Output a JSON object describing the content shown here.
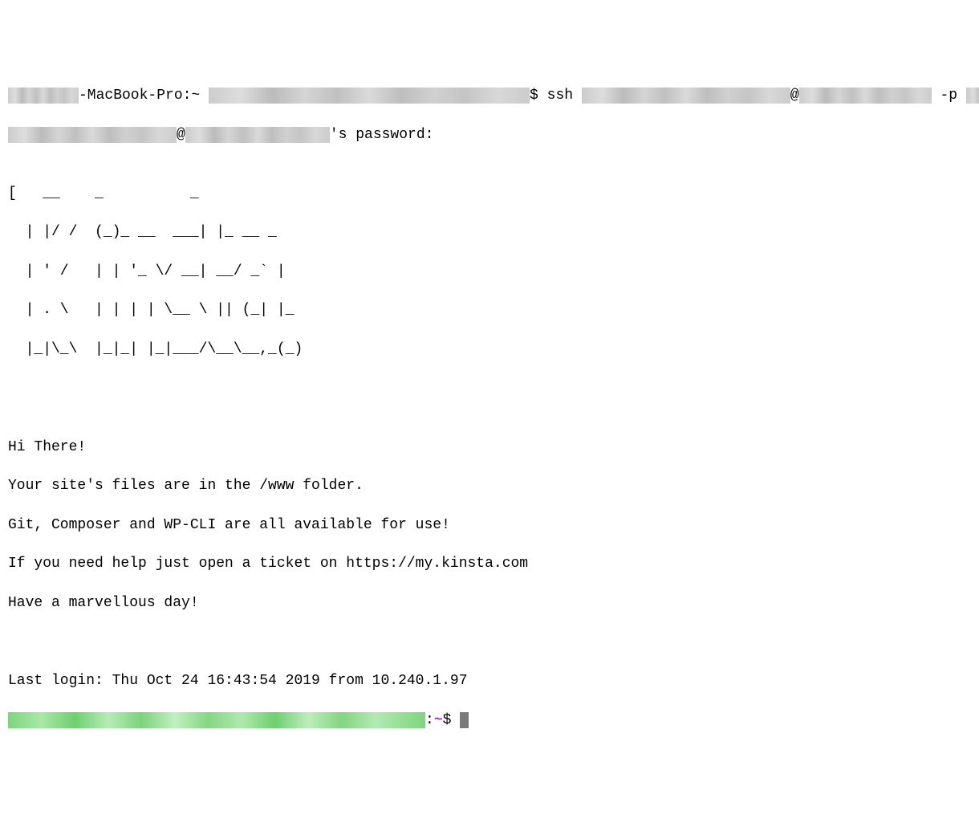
{
  "local_prompt": {
    "hostname_suffix": "-MacBook-Pro:~ ",
    "prompt_char": "$ ",
    "command": "ssh ",
    "at": "@",
    "flag": " -p "
  },
  "password_prompt": {
    "at": "@",
    "label": "'s password:"
  },
  "ascii_art_lines": [
    "[   __    _          _         ",
    "  | |/ /  (_)_ __  ___| |_ __ _   ",
    "  | ' /   | | '_ \\/ __| __/ _` |  ",
    "  | . \\   | | | | \\__ \\ || (_| |_ ",
    "  |_|\\_\\  |_|_| |_|___/\\__\\__,_(_)"
  ],
  "motd": {
    "line1": "Hi There!",
    "line2": "Your site's files are in the /www folder.",
    "line3": "Git, Composer and WP-CLI are all available for use!",
    "line4": "If you need help just open a ticket on https://my.kinsta.com",
    "line5": "Have a marvellous day!"
  },
  "last_login": "Last login: Thu Oct 24 16:43:54 2019 from 10.240.1.97",
  "remote_prompt": {
    "colon": ":",
    "tilde": "~",
    "char": "$ "
  },
  "redacted_widths": {
    "local_user_prefix": "88px",
    "local_username": "400px",
    "ssh_user": "260px",
    "ssh_host": "165px",
    "ssh_port": "90px",
    "pw_user": "210px",
    "pw_host": "180px",
    "remote_host": "520px"
  }
}
